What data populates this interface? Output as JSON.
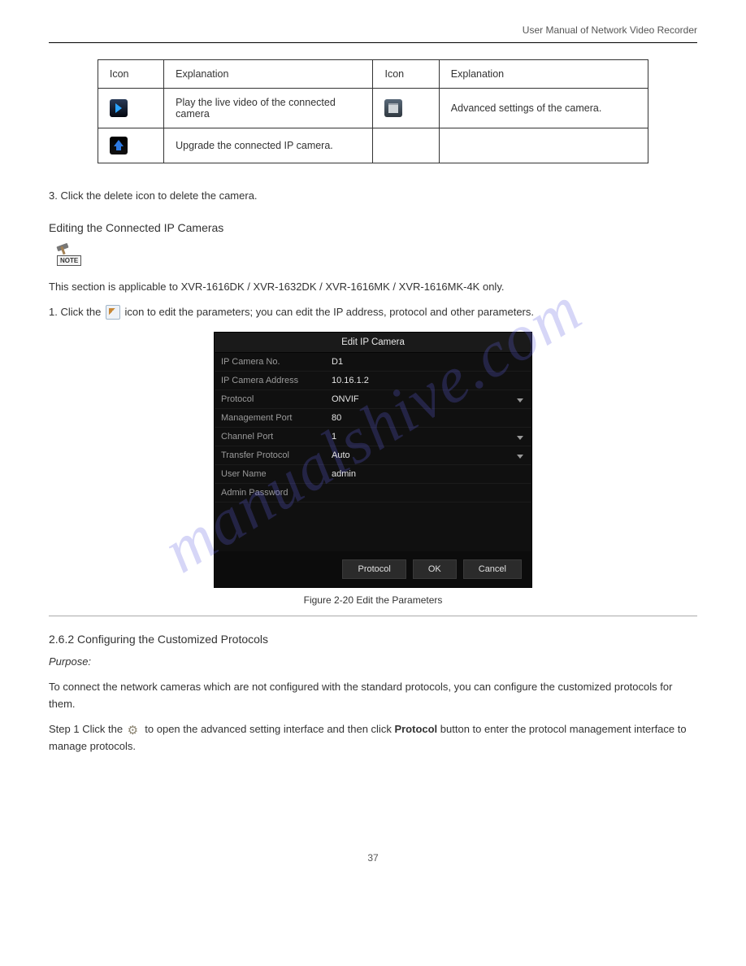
{
  "header": {
    "manual_title": "User Manual of Network Video Recorder"
  },
  "watermark": "manualshive.com",
  "icon_table": {
    "header": {
      "c1": "Icon",
      "c2": "Explanation",
      "c3": "Icon",
      "c4": "Explanation"
    },
    "rows": [
      {
        "d1": "Play the live video of the connected camera",
        "d2": "Advanced settings of the camera."
      },
      {
        "d1": "Upgrade the connected IP camera.",
        "d2": ""
      }
    ]
  },
  "step3": "3. Click the delete icon to delete the camera.",
  "section_edit": {
    "title": "Editing the Connected IP Cameras",
    "note": "This section is applicable to XVR-1616DK / XVR-1632DK / XVR-1616MK / XVR-1616MK-4K only.",
    "step1_prefix": "1. Click the ",
    "step1_suffix": " icon to edit the parameters; you can edit the IP address, protocol and other parameters."
  },
  "dialog": {
    "title": "Edit IP Camera",
    "rows": [
      {
        "label": "IP Camera No.",
        "value": "D1",
        "dd": false
      },
      {
        "label": "IP Camera Address",
        "value": "10.16.1.2",
        "dd": false
      },
      {
        "label": "Protocol",
        "value": "ONVIF",
        "dd": true
      },
      {
        "label": "Management Port",
        "value": "80",
        "dd": false
      },
      {
        "label": "Channel Port",
        "value": "1",
        "dd": true
      },
      {
        "label": "Transfer Protocol",
        "value": "Auto",
        "dd": true
      },
      {
        "label": "User Name",
        "value": "admin",
        "dd": false
      },
      {
        "label": "Admin Password",
        "value": "",
        "dd": false
      }
    ],
    "buttons": {
      "protocol": "Protocol",
      "ok": "OK",
      "cancel": "Cancel"
    },
    "caption": "Figure 2-20 Edit the Parameters"
  },
  "section_custom": {
    "heading": "2.6.2 Configuring the Customized Protocols",
    "purpose_label": "Purpose:",
    "purpose_text": "To connect the network cameras which are not configured with the standard protocols, you can configure the customized protocols for them.",
    "step1_prefix": "Step 1 Click the ",
    "step1_mid": " to open the advanced setting interface and then click ",
    "step1_bold": "Protocol",
    "step1_suffix": " button to enter the protocol management interface to manage protocols."
  },
  "footer": {
    "page": "37"
  }
}
